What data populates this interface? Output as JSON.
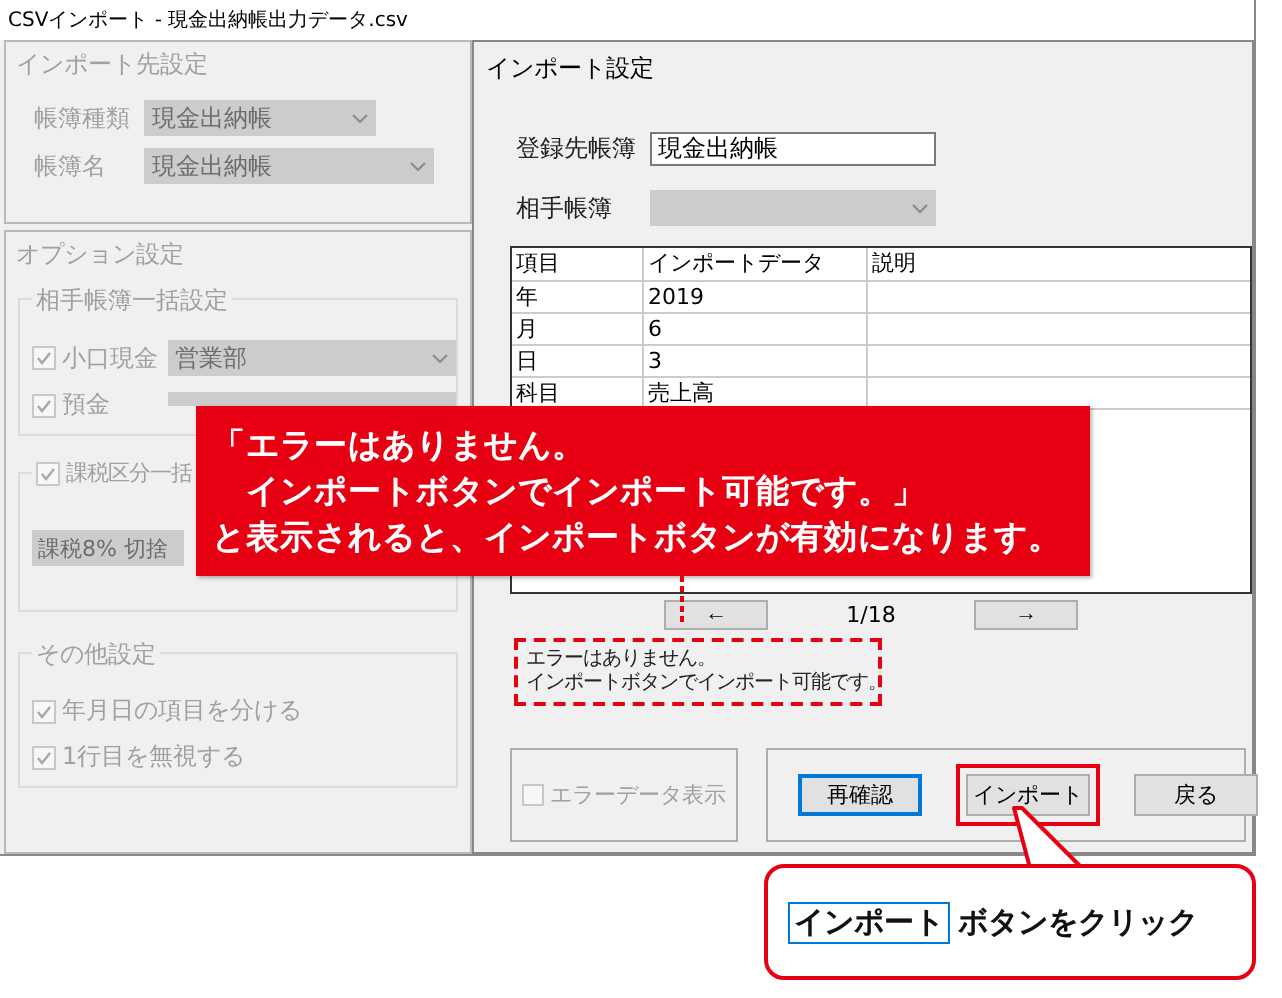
{
  "window": {
    "title": "CSVインポート - 現金出納帳出力データ.csv"
  },
  "import_target": {
    "heading": "インポート先設定",
    "fields": [
      {
        "label": "帳簿種類",
        "value": "現金出納帳"
      },
      {
        "label": "帳簿名",
        "value": "現金出納帳"
      }
    ]
  },
  "options": {
    "heading": "オプション設定",
    "counterpart_group": {
      "heading": "相手帳簿一括設定",
      "items": [
        {
          "label": "小口現金",
          "checked": true,
          "value": "営業部"
        },
        {
          "label": "預金",
          "checked": true
        }
      ]
    },
    "tax_group": {
      "heading": "課税区分一括",
      "checked": true,
      "value": "課税8% 切捨"
    },
    "other_group": {
      "heading": "その他設定",
      "items": [
        {
          "label": "年月日の項目を分ける",
          "checked": true
        },
        {
          "label": "1行目を無視する",
          "checked": true
        }
      ]
    }
  },
  "import_settings": {
    "heading": "インポート設定",
    "register": {
      "label": "登録先帳簿",
      "value": "現金出納帳"
    },
    "counterpart": {
      "label": "相手帳簿"
    },
    "table": {
      "columns": [
        "項目",
        "インポートデータ",
        "説明"
      ],
      "rows": [
        [
          "年",
          "2019",
          ""
        ],
        [
          "月",
          "6",
          ""
        ],
        [
          "日",
          "3",
          ""
        ],
        [
          "科目",
          "売上高",
          ""
        ]
      ]
    },
    "pager": {
      "prev": "←",
      "page": "1/18",
      "next": "→"
    },
    "message": [
      "エラーはありません。",
      "インポートボタンでインポート可能です。"
    ]
  },
  "error_display": {
    "label": "エラーデータ表示",
    "checked": false
  },
  "buttons": [
    {
      "label": "再確認",
      "focused": true,
      "highlighted": false
    },
    {
      "label": "インポート",
      "focused": false,
      "highlighted": true
    },
    {
      "label": "戻る",
      "focused": false,
      "highlighted": false
    }
  ],
  "callout": {
    "lines": [
      "「エラーはありません。",
      "　インポートボタンでインポート可能です。」",
      "と表示されると、インポートボタンが有効になります。"
    ]
  },
  "click_hint": {
    "button": "インポート",
    "text": "ボタンをクリック"
  }
}
